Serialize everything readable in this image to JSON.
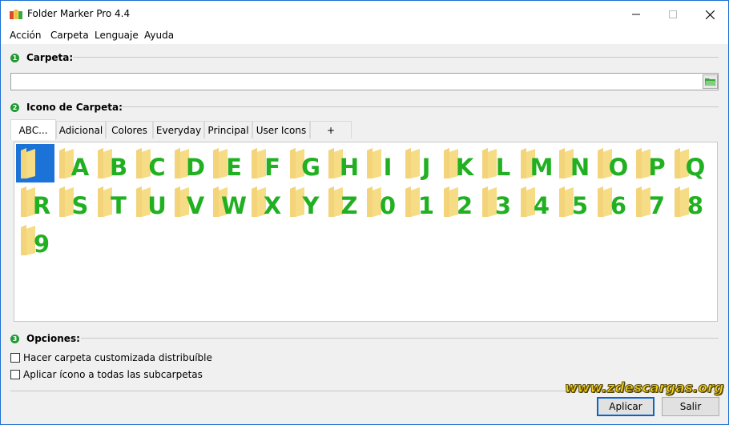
{
  "window": {
    "title": "Folder Marker Pro 4.4",
    "minimize": "—",
    "maximize": "☐",
    "close": "✕"
  },
  "menu": [
    "Acción",
    "Carpeta",
    "Lenguaje",
    "Ayuda"
  ],
  "sections": {
    "folder": {
      "num": "1",
      "label": "Carpeta:"
    },
    "icon": {
      "num": "2",
      "label": "Icono de Carpeta:"
    },
    "options": {
      "num": "3",
      "label": "Opciones:"
    }
  },
  "folder_path": {
    "value": "",
    "placeholder": ""
  },
  "tabs": [
    "ABC...",
    "Adicional",
    "Colores",
    "Everyday",
    "Principal",
    "User Icons",
    "+"
  ],
  "active_tab": 0,
  "icons": [
    "",
    "A",
    "B",
    "C",
    "D",
    "E",
    "F",
    "G",
    "H",
    "I",
    "J",
    "K",
    "L",
    "M",
    "N",
    "O",
    "P",
    "Q",
    "R",
    "S",
    "T",
    "U",
    "V",
    "W",
    "X",
    "Y",
    "Z",
    "0",
    "1",
    "2",
    "3",
    "4",
    "5",
    "6",
    "7",
    "8",
    "9"
  ],
  "selected_icon": 0,
  "options": [
    {
      "label": "Hacer carpeta customizada distribuíble",
      "checked": false
    },
    {
      "label": "Aplicar ícono a todas las subcarpetas",
      "checked": false
    }
  ],
  "buttons": {
    "apply": "Aplicar",
    "exit": "Salir"
  },
  "watermark": "www.zdescargas.org",
  "colors": {
    "accent": "#1b73d8",
    "letter": "#21b021",
    "folder": "#f5d77e",
    "step_badge": "#1f9a33"
  }
}
